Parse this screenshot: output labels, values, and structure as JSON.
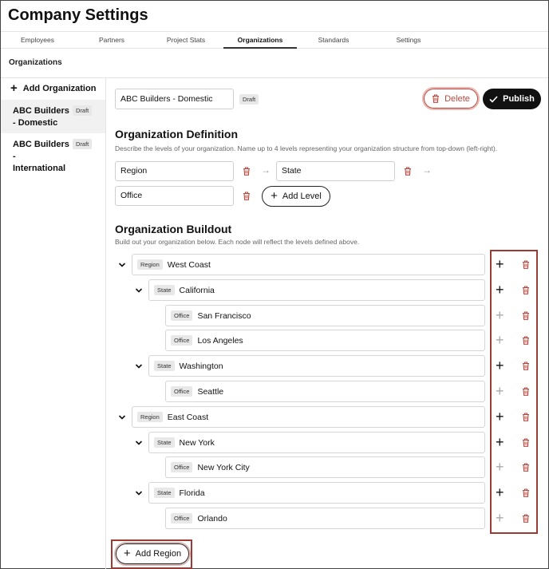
{
  "app": {
    "title": "Company Settings"
  },
  "tabs": [
    {
      "label": "Employees",
      "active": false
    },
    {
      "label": "Partners",
      "active": false
    },
    {
      "label": "Project Stats",
      "active": false
    },
    {
      "label": "Organizations",
      "active": true
    },
    {
      "label": "Standards",
      "active": false
    },
    {
      "label": "Settings",
      "active": false
    }
  ],
  "section": {
    "label": "Organizations"
  },
  "sidebar": {
    "add_label": "Add Organization",
    "items": [
      {
        "name": "ABC Builders - Domestic",
        "badge": "Draft",
        "selected": true
      },
      {
        "name": "ABC Builders - International",
        "badge": "Draft",
        "selected": false
      }
    ]
  },
  "editor": {
    "org_name_value": "ABC Builders - Domestic",
    "status_badge": "Draft",
    "delete_label": "Delete",
    "publish_label": "Publish"
  },
  "definition": {
    "title": "Organization Definition",
    "description": "Describe the levels of your organization. Name up to 4 levels representing your organization structure from top-down (left-right).",
    "levels": [
      "Region",
      "State",
      "Office"
    ],
    "add_level_label": "Add Level"
  },
  "buildout": {
    "title": "Organization Buildout",
    "description": "Build out your organization below. Each node will reflect the levels defined above.",
    "nodes": [
      {
        "level": "Region",
        "name": "West Coast",
        "can_add": true
      },
      {
        "level": "State",
        "name": "California",
        "can_add": true
      },
      {
        "level": "Office",
        "name": "San Francisco",
        "can_add": false
      },
      {
        "level": "Office",
        "name": "Los Angeles",
        "can_add": false
      },
      {
        "level": "State",
        "name": "Washington",
        "can_add": true
      },
      {
        "level": "Office",
        "name": "Seattle",
        "can_add": false
      },
      {
        "level": "Region",
        "name": "East Coast",
        "can_add": true
      },
      {
        "level": "State",
        "name": "New York",
        "can_add": true
      },
      {
        "level": "Office",
        "name": "New York City",
        "can_add": false
      },
      {
        "level": "State",
        "name": "Florida",
        "can_add": true
      },
      {
        "level": "Office",
        "name": "Orlando",
        "can_add": false
      }
    ],
    "add_region_label": "Add Region"
  },
  "colors": {
    "accent": "#b84a40",
    "highlight": "#9a3b34",
    "primary": "#111111"
  }
}
